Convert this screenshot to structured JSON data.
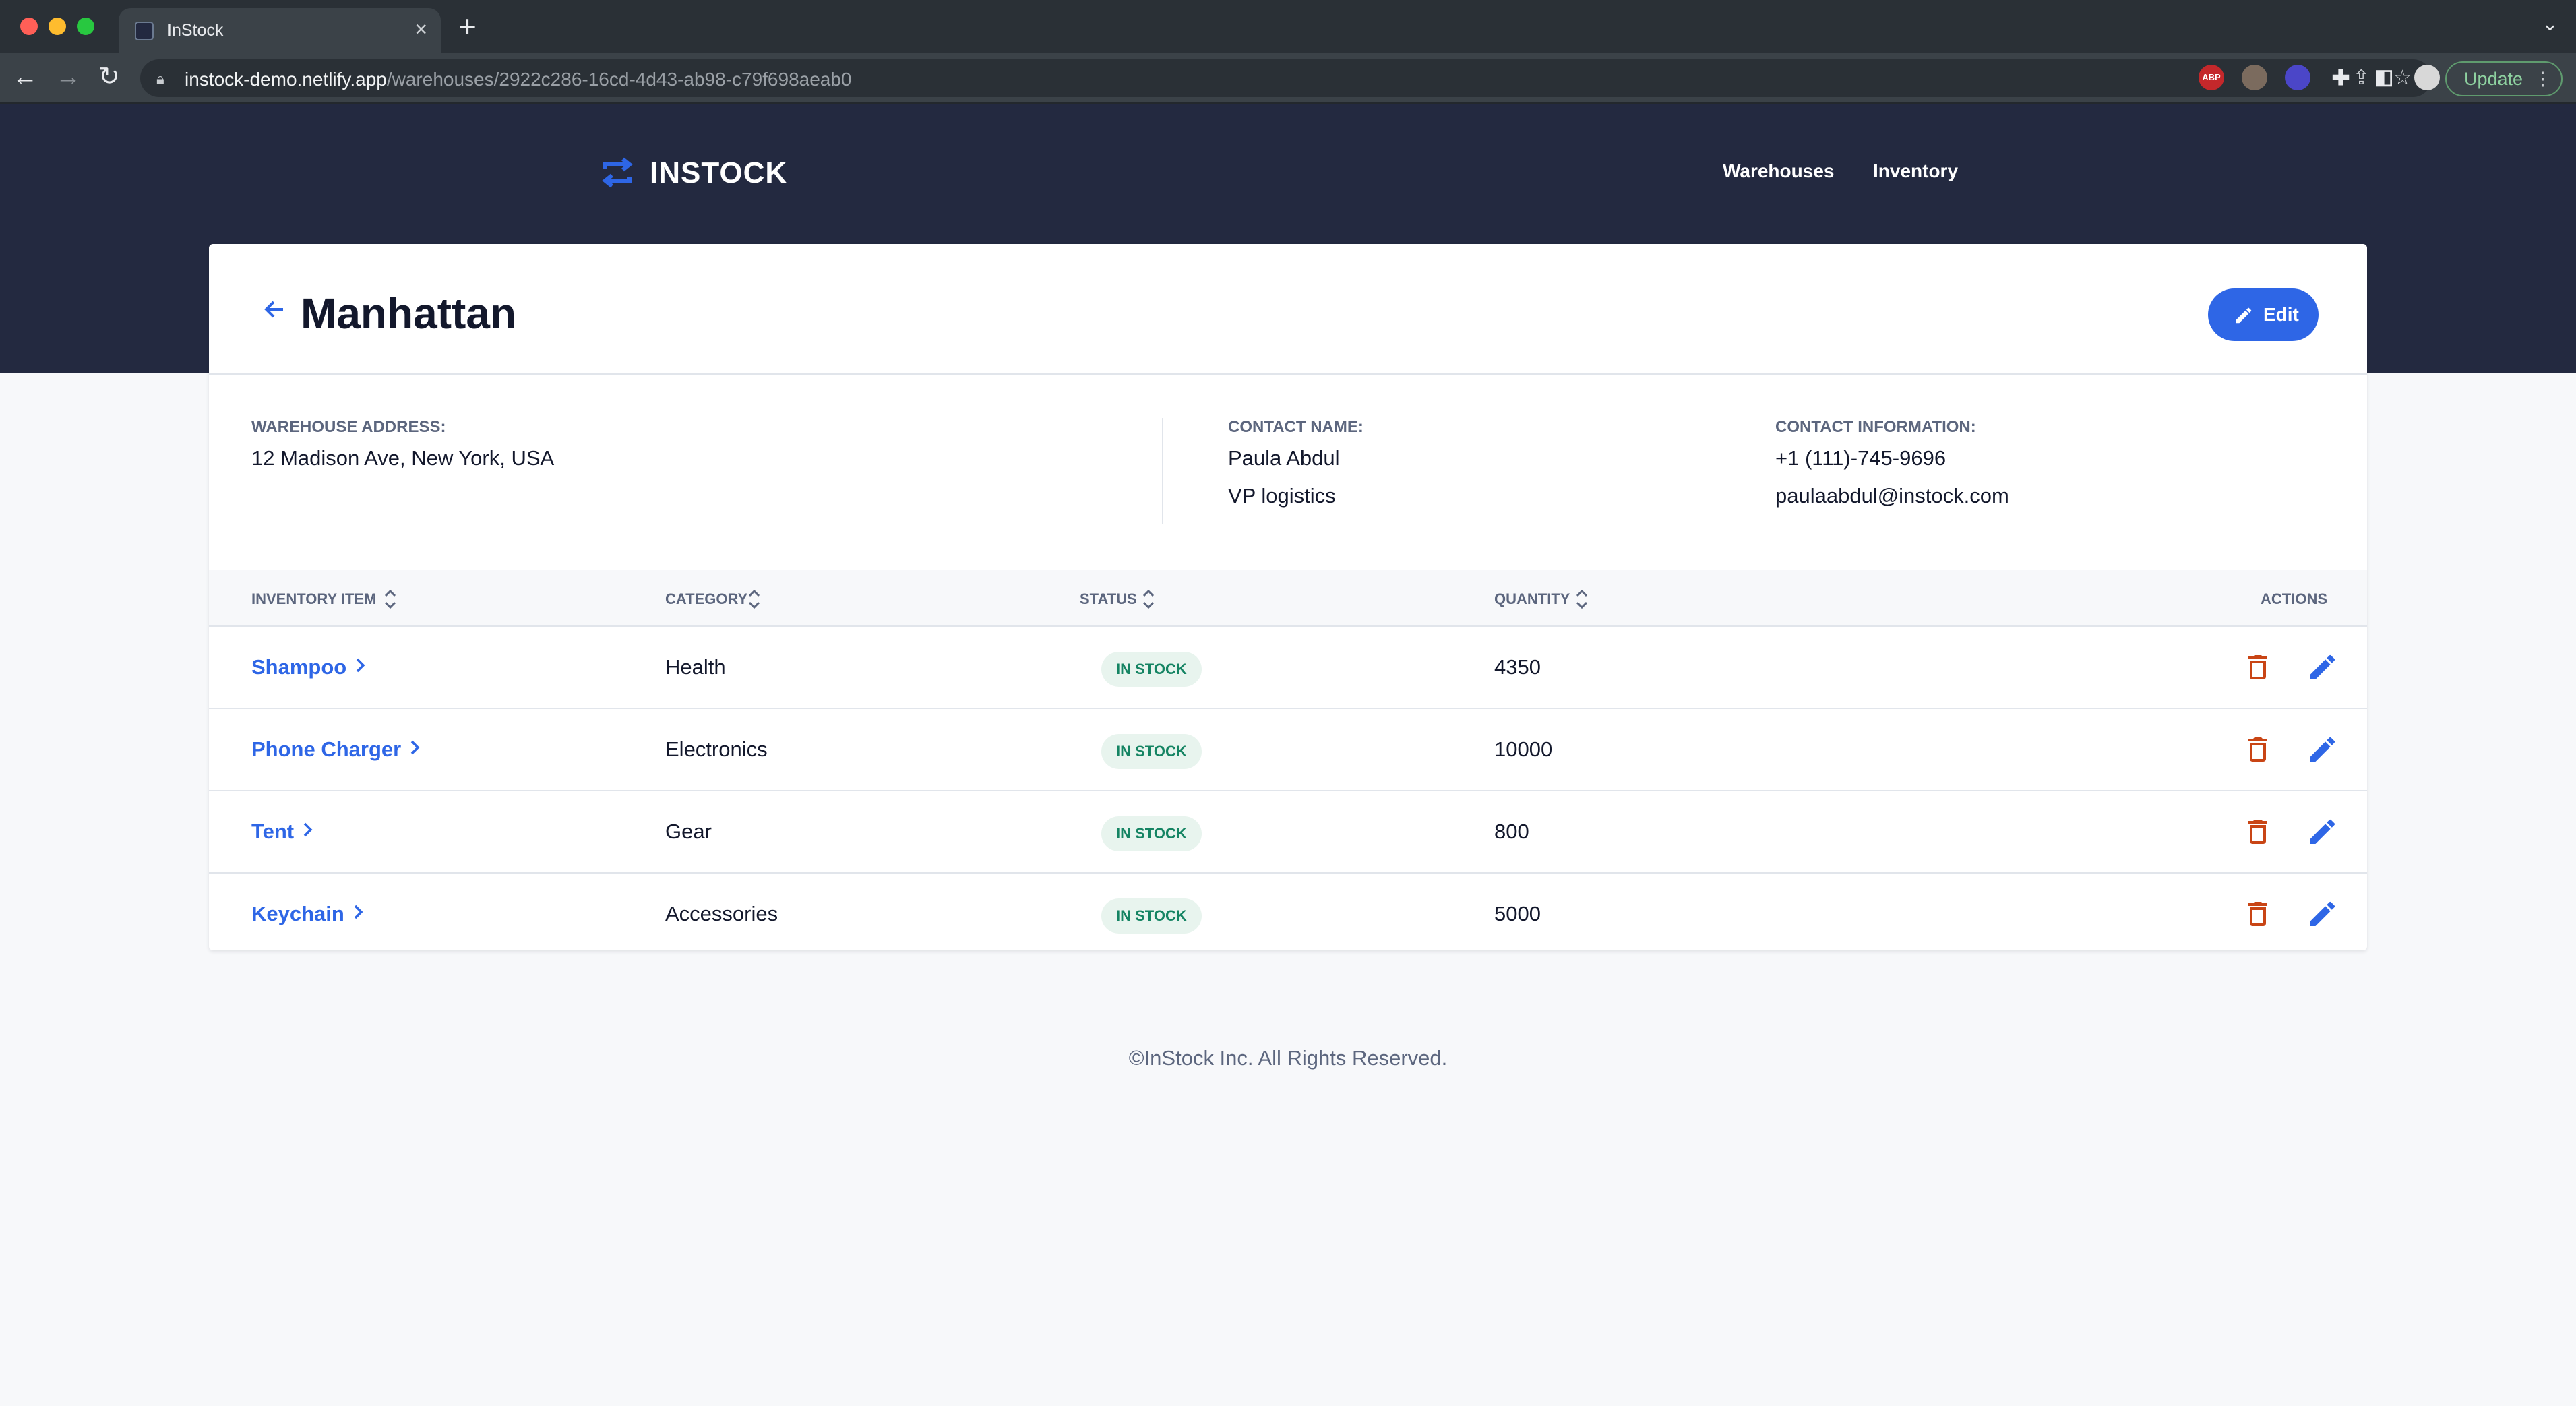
{
  "browser": {
    "tab_title": "InStock",
    "url_host": "instock-demo.netlify.app",
    "url_path": "/warehouses/2922c286-16cd-4d43-ab98-c79f698aeab0",
    "update_label": "Update",
    "extensions": [
      "ABP"
    ]
  },
  "header": {
    "logo_text": "INSTOCK",
    "nav": [
      "Warehouses",
      "Inventory"
    ]
  },
  "warehouse": {
    "name": "Manhattan",
    "edit_label": "Edit",
    "address_label": "WAREHOUSE ADDRESS:",
    "address": "12 Madison Ave, New York, USA",
    "contact_name_label": "CONTACT NAME:",
    "contact_name": "Paula Abdul",
    "contact_position": "VP logistics",
    "contact_info_label": "CONTACT INFORMATION:",
    "phone": "+1 (111)-745-9696",
    "email": "paulaabdul@instock.com"
  },
  "table": {
    "headers": {
      "item": "INVENTORY ITEM",
      "category": "CATEGORY",
      "status": "STATUS",
      "quantity": "QUANTITY",
      "actions": "ACTIONS"
    },
    "rows": [
      {
        "item": "Shampoo",
        "category": "Health",
        "status": "IN STOCK",
        "quantity": "4350"
      },
      {
        "item": "Phone Charger",
        "category": "Electronics",
        "status": "IN STOCK",
        "quantity": "10000"
      },
      {
        "item": "Tent",
        "category": "Gear",
        "status": "IN STOCK",
        "quantity": "800"
      },
      {
        "item": "Keychain",
        "category": "Accessories",
        "status": "IN STOCK",
        "quantity": "5000"
      }
    ]
  },
  "footer": {
    "text": "©InStock Inc. All Rights Reserved."
  },
  "colors": {
    "header_bg": "#232940",
    "accent_blue": "#2e66e6",
    "delete_red": "#c94515",
    "status_green": "#158463"
  }
}
